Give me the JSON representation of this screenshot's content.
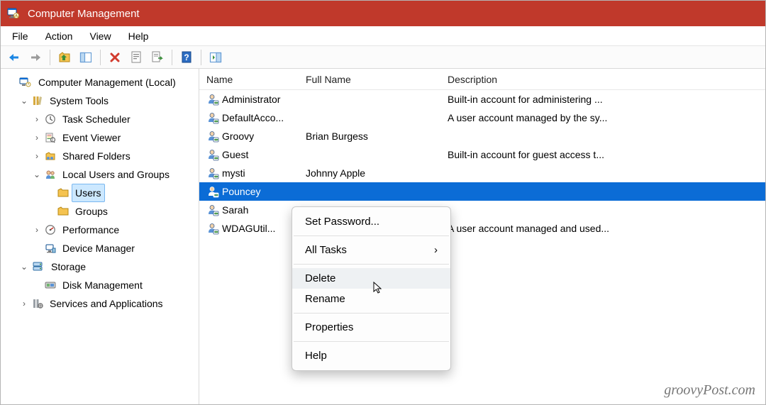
{
  "title": "Computer Management",
  "menubar": {
    "file": "File",
    "action": "Action",
    "view": "View",
    "help": "Help"
  },
  "tree": {
    "root": "Computer Management (Local)",
    "system_tools": "System Tools",
    "task_scheduler": "Task Scheduler",
    "event_viewer": "Event Viewer",
    "shared_folders": "Shared Folders",
    "local_users_groups": "Local Users and Groups",
    "users": "Users",
    "groups": "Groups",
    "performance": "Performance",
    "device_manager": "Device Manager",
    "storage": "Storage",
    "disk_management": "Disk Management",
    "services_apps": "Services and Applications"
  },
  "columns": {
    "name": "Name",
    "fullname": "Full Name",
    "description": "Description"
  },
  "users": [
    {
      "name": "Administrator",
      "fullname": "",
      "description": "Built-in account for administering ..."
    },
    {
      "name": "DefaultAcco...",
      "fullname": "",
      "description": "A user account managed by the sy..."
    },
    {
      "name": "Groovy",
      "fullname": "Brian Burgess",
      "description": ""
    },
    {
      "name": "Guest",
      "fullname": "",
      "description": "Built-in account for guest access t..."
    },
    {
      "name": "mysti",
      "fullname": "Johnny Apple",
      "description": ""
    },
    {
      "name": "Pouncey",
      "fullname": "",
      "description": ""
    },
    {
      "name": "Sarah",
      "fullname": "",
      "description": ""
    },
    {
      "name": "WDAGUtil...",
      "fullname": "",
      "description": "A user account managed and used..."
    }
  ],
  "selected_user_index": 5,
  "context_menu": {
    "set_password": "Set Password...",
    "all_tasks": "All Tasks",
    "delete": "Delete",
    "rename": "Rename",
    "properties": "Properties",
    "help": "Help"
  },
  "watermark": "groovyPost.com"
}
